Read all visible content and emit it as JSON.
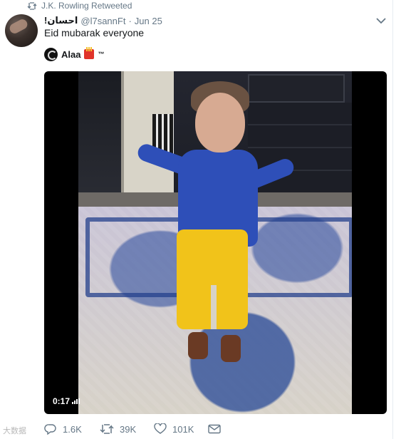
{
  "retweet_context": {
    "text": "J.K. Rowling Retweeted",
    "icon": "retweet-icon"
  },
  "tweet": {
    "author": {
      "display_name": "احسان!",
      "handle": "@l7sannFt"
    },
    "separator": "·",
    "date": "Jun 25",
    "text": "Eid mubarak everyone",
    "attribution": {
      "name": "Alaa",
      "badge_icon": "fries-emoji-icon",
      "suffix": "™"
    },
    "media": {
      "type": "video",
      "duration": "0:17"
    },
    "actions": {
      "reply": {
        "icon": "reply-icon",
        "count": "1.6K"
      },
      "retweet": {
        "icon": "retweet-icon",
        "count": "39K"
      },
      "like": {
        "icon": "heart-icon",
        "count": "101K"
      },
      "message": {
        "icon": "envelope-icon"
      }
    }
  },
  "colors": {
    "secondary_text": "#657786",
    "primary_text": "#14171a",
    "background": "#ffffff"
  },
  "watermark": "大数据"
}
